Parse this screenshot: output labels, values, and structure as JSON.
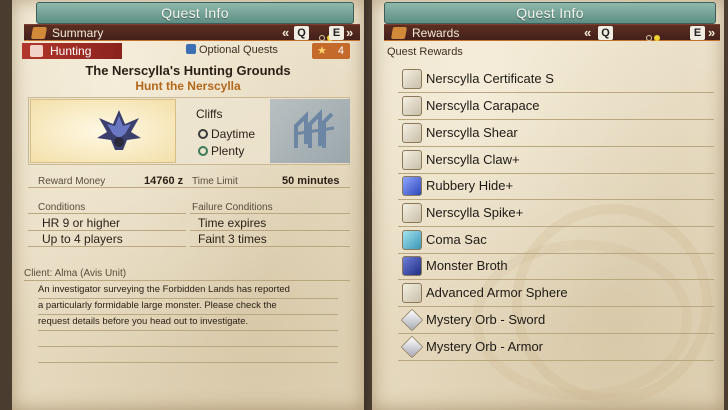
{
  "left": {
    "title": "Quest Info",
    "tab": {
      "label": "Summary",
      "prev_key": "Q",
      "next_key": "E",
      "prev_arrows": "«",
      "next_arrows": "»"
    },
    "quest_type": "Hunting",
    "optional_quests": "Optional Quests",
    "star_rating": "4",
    "quest_name": "The Nerscylla's Hunting Grounds",
    "quest_subtitle": "Hunt the Nerscylla",
    "location": "Cliffs",
    "time_of_day": "Daytime",
    "environment": "Plenty",
    "reward_money_label": "Reward Money",
    "reward_money_value": "14760 z",
    "time_limit_label": "Time Limit",
    "time_limit_value": "50 minutes",
    "conditions_label": "Conditions",
    "conditions": [
      "HR 9 or higher",
      "Up to 4 players"
    ],
    "failure_label": "Failure Conditions",
    "failure_conditions": [
      "Time expires",
      "Faint 3 times"
    ],
    "client": "Client: Alma (Avis Unit)",
    "description_lines": [
      "An investigator surveying the Forbidden Lands has reported",
      "a particularly formidable large monster. Please check the",
      "request details before you head out to investigate."
    ]
  },
  "right": {
    "title": "Quest Info",
    "tab": {
      "label": "Rewards",
      "prev_key": "Q",
      "next_key": "E",
      "prev_arrows": "«",
      "next_arrows": "»"
    },
    "rewards_header": "Quest Rewards",
    "rewards": [
      {
        "name": "Nerscylla Certificate S",
        "icon": "certificate-icon"
      },
      {
        "name": "Nerscylla Carapace",
        "icon": "carapace-icon"
      },
      {
        "name": "Nerscylla Shear",
        "icon": "shear-icon"
      },
      {
        "name": "Nerscylla Claw+",
        "icon": "claw-icon"
      },
      {
        "name": "Rubbery Hide+",
        "icon": "hide-icon"
      },
      {
        "name": "Nerscylla Spike+",
        "icon": "spike-icon"
      },
      {
        "name": "Coma Sac",
        "icon": "sac-icon"
      },
      {
        "name": "Monster Broth",
        "icon": "broth-icon"
      },
      {
        "name": "Advanced Armor Sphere",
        "icon": "armor-sphere-icon"
      },
      {
        "name": "Mystery Orb - Sword",
        "icon": "mystery-orb-icon"
      },
      {
        "name": "Mystery Orb - Armor",
        "icon": "mystery-orb-icon"
      }
    ]
  },
  "colors": {
    "title_bar": "#6f9f94",
    "tab_bar": "#4e261d",
    "quest_type": "#b2362c",
    "subtitle": "#b3671b",
    "parchment": "#e9dfc8"
  }
}
